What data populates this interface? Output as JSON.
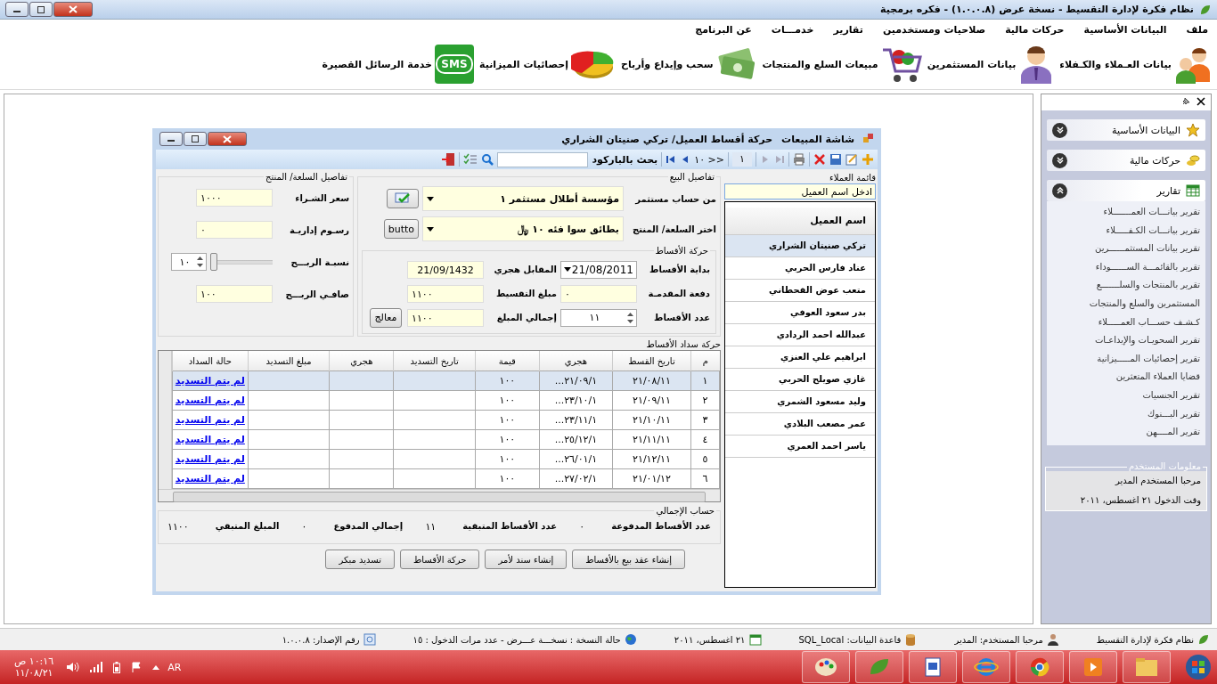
{
  "window": {
    "title": "نظام فكرة لإدارة التقسيط - نسخة عرض (١.٠.٠.٨) - فكره برمجية"
  },
  "menu": [
    {
      "label": "ملف"
    },
    {
      "label": "البيانات الأساسية"
    },
    {
      "label": "حركات مالية"
    },
    {
      "label": "صلاحيات ومستخدمين"
    },
    {
      "label": "تقارير"
    },
    {
      "label": "خدمـــات"
    },
    {
      "label": "عن البرنامج"
    }
  ],
  "toolbar": [
    {
      "kind": "people",
      "label": "بيانات العـملاء والكـفلاء"
    },
    {
      "kind": "person",
      "label": "بيانات المستثمرين"
    },
    {
      "kind": "cart",
      "label": "مبيعات السلع والمنتجات"
    },
    {
      "kind": "money",
      "label": "سحب وإيداع وأرباح"
    },
    {
      "kind": "pie",
      "label": "إحصائيات الميزانية"
    },
    {
      "kind": "sms",
      "label": "خدمة الرسائل القصيرة",
      "icon_text": "SMS"
    }
  ],
  "sales_window": {
    "title": "شاشة المبيعات",
    "subtitle": "حركة أقساط العميل/ تركي صنيتان الشراري",
    "nav": {
      "page": "١",
      "range": "١٠ >>",
      "barcode_label": "بحث بالباركود"
    },
    "product_details": {
      "title": "تفاصيل السلعة/ المنتج",
      "fields": [
        {
          "kind": "text",
          "label": "سعر الشـراء",
          "value": "١٠٠٠"
        },
        {
          "kind": "text",
          "label": "رسـوم إداريـة",
          "value": "٠"
        },
        {
          "kind": "slider",
          "label": "نسبـة الربـــح",
          "value": "١٠",
          "level": 0.1
        },
        {
          "kind": "text",
          "label": "صافـي الربـــح",
          "value": "١٠٠"
        }
      ]
    },
    "sale_details": {
      "title": "تفاصيل البيع",
      "investor_label": "من حساب مستثمر",
      "investor": "مؤسسة أطلال مستثمر ١",
      "product_label": "اختر السلعة/ المنتج",
      "product": "بطائق سوا فئه ١٠ ﷼",
      "product_button": "butto"
    },
    "installments": {
      "title": "حركة الأقساط",
      "start_label": "بداية الأقساط",
      "start_date": "21/08/2011",
      "hijri_label": "المقابل هجري",
      "hijri": "21/09/1432",
      "down_label": "دفعة المقدمـة",
      "down": "٠",
      "amount_label": "مبلغ التقسيط",
      "amount": "١١٠٠",
      "count_label": "عدد الأقساط",
      "count": "١١",
      "total_label": "إجمالي المبلغ",
      "total": "١١٠٠",
      "process_button": "معالج"
    },
    "payments": {
      "title": "حركة سداد الأقساط",
      "columns": [
        "م",
        "تاريخ القسط",
        "هجري",
        "قيمة",
        "تاريخ التسديد",
        "هجري",
        "مبلغ التسديد",
        "حالة السداد"
      ],
      "rows": [
        {
          "selected": true,
          "cells": [
            "١",
            "٢١/٠٨/١١",
            "٢١/٠٩/١...",
            "١٠٠",
            "",
            "",
            "",
            "لم يتم التسديد"
          ]
        },
        {
          "selected": false,
          "cells": [
            "٢",
            "٢١/٠٩/١١",
            "٢٣/١٠/١...",
            "١٠٠",
            "",
            "",
            "",
            "لم يتم التسديد"
          ]
        },
        {
          "selected": false,
          "cells": [
            "٣",
            "٢١/١٠/١١",
            "٢٣/١١/١...",
            "١٠٠",
            "",
            "",
            "",
            "لم يتم التسديد"
          ]
        },
        {
          "selected": false,
          "cells": [
            "٤",
            "٢١/١١/١١",
            "٢٥/١٢/١...",
            "١٠٠",
            "",
            "",
            "",
            "لم يتم التسديد"
          ]
        },
        {
          "selected": false,
          "cells": [
            "٥",
            "٢١/١٢/١١",
            "٢٦/٠١/١...",
            "١٠٠",
            "",
            "",
            "",
            "لم يتم التسديد"
          ]
        },
        {
          "selected": false,
          "cells": [
            "٦",
            "٢١/٠١/١٢",
            "٢٧/٠٢/١...",
            "١٠٠",
            "",
            "",
            "",
            "لم يتم التسديد"
          ]
        }
      ]
    },
    "summary": {
      "title": "حساب الإجمالي",
      "items": [
        {
          "label": "عدد الأقساط المدفوعة",
          "value": "٠"
        },
        {
          "label": "عدد الأقساط المتبقية",
          "value": "١١"
        },
        {
          "label": "إجمالي المدفوع",
          "value": "٠"
        },
        {
          "label": "المبلغ المتبقي",
          "value": "١١٠٠"
        }
      ]
    },
    "buttons": [
      "إنشاء عقد بيع بالأقساط",
      "إنشاء سند لأمر",
      "حركة الأقساط",
      "تسديد مبكر"
    ],
    "customers": {
      "title": "قائمة العملاء",
      "search": "ادخل اسم العميل",
      "header": "اسم العميل",
      "rows": [
        {
          "name": "تركي صنيتان الشراري",
          "selected": true
        },
        {
          "name": "عناد فارس الحربي",
          "selected": false
        },
        {
          "name": "متعب عوض القحطاني",
          "selected": false
        },
        {
          "name": "بدر سعود العوفي",
          "selected": false
        },
        {
          "name": "عبدالله احمد الردادي",
          "selected": false
        },
        {
          "name": "ابراهيم علي العنزي",
          "selected": false
        },
        {
          "name": "غازي صويلح الحربي",
          "selected": false
        },
        {
          "name": "وليد مسعود الشمري",
          "selected": false
        },
        {
          "name": "عمر مصعب البلادي",
          "selected": false
        },
        {
          "name": "ياسر احمد العمري",
          "selected": false
        }
      ]
    }
  },
  "sidebar": {
    "sections": [
      {
        "kind": "star",
        "label": "البيانات الأساسية",
        "expanded": false
      },
      {
        "kind": "coins",
        "label": "حركات مالية",
        "expanded": false
      },
      {
        "kind": "report",
        "label": "تقارير",
        "expanded": true,
        "items": [
          "تقرير بيانـــات العمـــــــلاء",
          "تقرير بيانـــات الكـفـــــلاء",
          "تقرير بيانات المستثمــــــرين",
          "تقرير بالقائمـــة الســــــوداء",
          "تقرير بالمنتجات والسلـــــــع",
          "المستثمرين والسلع والمنتجات",
          "كـشـف حســـاب العمـــــلاء",
          "تقرير السحويـات والإيداعـات",
          "تقرير إحصائيات المـــــيزانية",
          "قضايا العملاء المتعثرين",
          "تقرير الجنسيات",
          "تقرير   البـــنوك",
          "تقرير المــــهن"
        ]
      }
    ],
    "user_info": {
      "title": "معلومات المستخدم",
      "lines": [
        "مرحبا المستخدم المدير",
        "وقت الدخول ٢١ اغسطس، ٢٠١١"
      ]
    }
  },
  "status_bar": [
    {
      "kind": "leaf",
      "text": "نظام فكرة لإدارة التقسيط"
    },
    {
      "kind": "user",
      "text": "مرحبا المستخدم: المدير"
    },
    {
      "kind": "database",
      "text": "قاعدة البيانات: SQL_Local"
    },
    {
      "kind": "calendar",
      "text": "٢١ اغسطس، ٢٠١١"
    },
    {
      "kind": "globe",
      "text": "حالة النسخة : نسخـــة عـــرض - عدد مرات الدخول : ١٥"
    },
    {
      "kind": "version",
      "text": "رقم الإصدار: ١.٠.٠.٨"
    }
  ],
  "taskbar": {
    "language": "AR",
    "time": "١٠:١٦ ص",
    "date": "١١/٠٨/٢١"
  }
}
